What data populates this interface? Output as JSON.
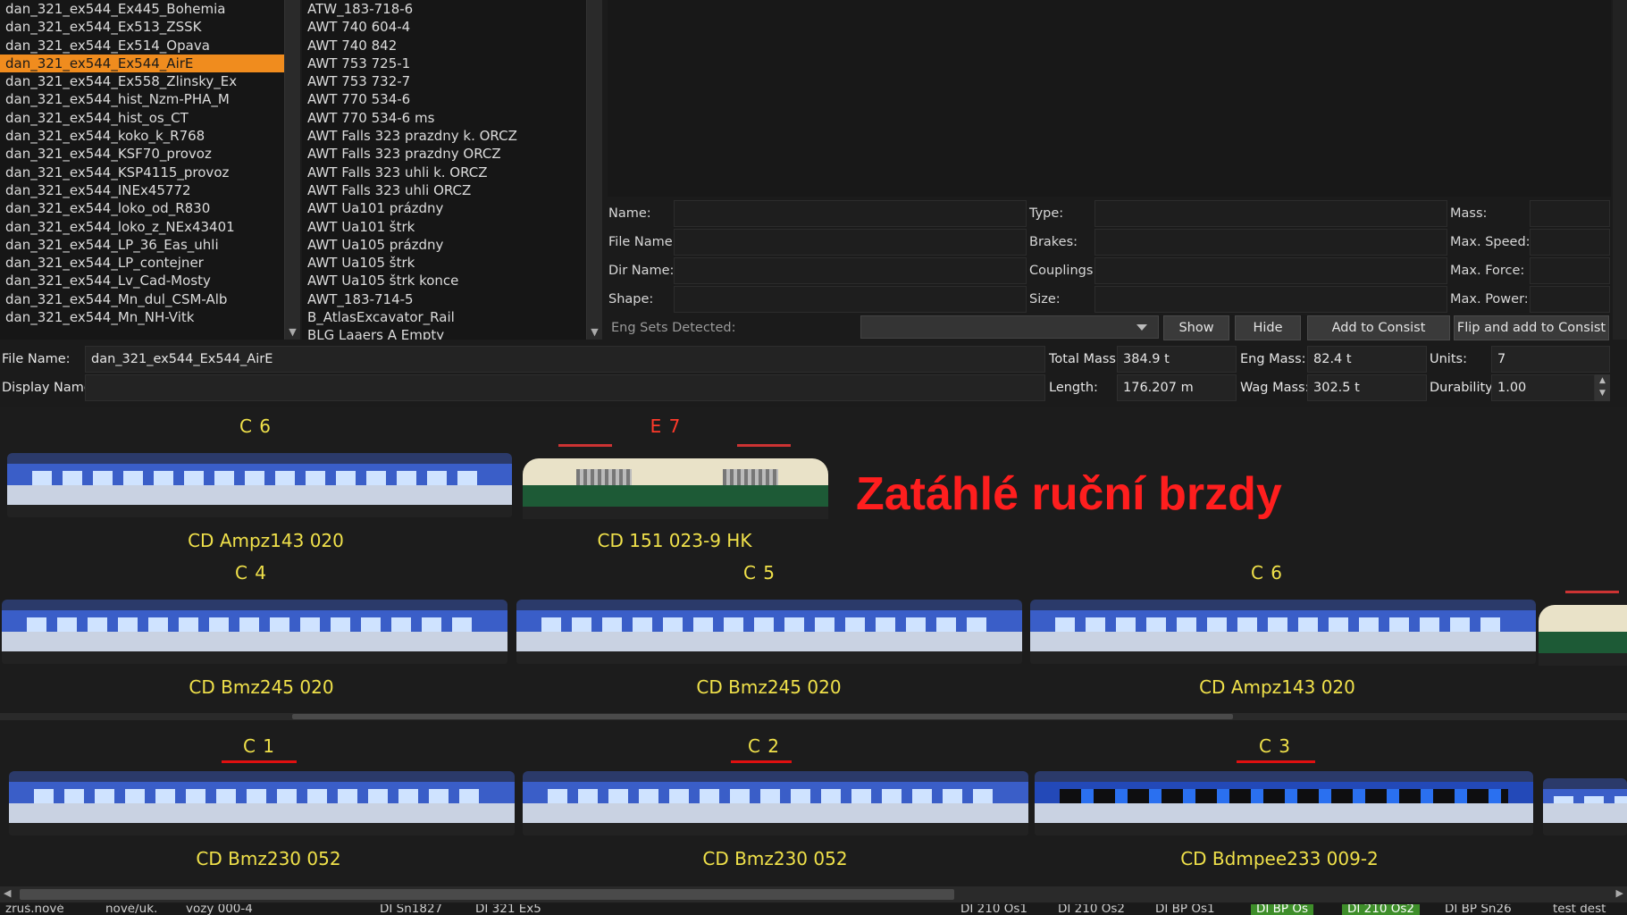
{
  "consist_list": {
    "items": [
      "dan_321_ex544_Ex445_Bohemia",
      "dan_321_ex544_Ex513_ZSSK",
      "dan_321_ex544_Ex514_Opava",
      "dan_321_ex544_Ex544_AirE",
      "dan_321_ex544_Ex558_Zlinsky_Ex",
      "dan_321_ex544_hist_Nzm-PHA_M",
      "dan_321_ex544_hist_os_CT",
      "dan_321_ex544_koko_k_R768",
      "dan_321_ex544_KSF70_provoz",
      "dan_321_ex544_KSP4115_provoz",
      "dan_321_ex544_INEx45772",
      "dan_321_ex544_loko_od_R830",
      "dan_321_ex544_loko_z_NEx43401",
      "dan_321_ex544_LP_36_Eas_uhli",
      "dan_321_ex544_LP_contejner",
      "dan_321_ex544_Lv_Cad-Mosty",
      "dan_321_ex544_Mn_dul_CSM-Alb",
      "dan_321_ex544_Mn_NH-Vitk"
    ],
    "selected": "dan_321_ex544_Ex544_AirE"
  },
  "wagon_list": {
    "items": [
      "ATW_183-718-6",
      "AWT 740 604-4",
      "AWT 740 842",
      "AWT 753 725-1",
      "AWT 753 732-7",
      "AWT 770 534-6",
      "AWT 770 534-6 ms",
      "AWT Falls 323 prazdny k. ORCZ",
      "AWT Falls 323 prazdny ORCZ",
      "AWT Falls 323 uhli k. ORCZ",
      "AWT Falls 323 uhli ORCZ",
      "AWT Ua101 prázdny",
      "AWT Ua101 štrk",
      "AWT Ua105 prázdny",
      "AWT Ua105 štrk",
      "AWT Ua105 štrk konce",
      "AWT_183-714-5",
      "B_AtlasExcavator_Rail",
      "BLG Laaers A Empty"
    ]
  },
  "properties": {
    "name_label": "Name:",
    "file_name_label": "File Name:",
    "dir_name_label": "Dir Name:",
    "shape_label": "Shape:",
    "type_label": "Type:",
    "brakes_label": "Brakes:",
    "couplings_label": "Couplings:",
    "size_label": "Size:",
    "mass_label": "Mass:",
    "max_speed_label": "Max. Speed:",
    "max_force_label": "Max. Force:",
    "max_power_label": "Max. Power:",
    "eng_sets_label": "Eng Sets Detected:",
    "show_button": "Show",
    "hide_button": "Hide",
    "add_button": "Add to Consist",
    "flip_add_button": "Flip and add to Consist"
  },
  "consist_info": {
    "file_name_label": "File Name:",
    "file_name_value": "dan_321_ex544_Ex544_AirE",
    "display_name_label": "Display Name:",
    "display_name_value": "",
    "total_mass_label": "Total Mass:",
    "total_mass_value": "384.9 t",
    "length_label": "Length:",
    "length_value": "176.207 m",
    "eng_mass_label": "Eng Mass:",
    "eng_mass_value": "82.4 t",
    "wag_mass_label": "Wag Mass:",
    "wag_mass_value": "302.5 t",
    "units_label": "Units:",
    "units_value": "7",
    "durability_label": "Durability:",
    "durability_value": "1.00"
  },
  "consist_view": {
    "warning": "Zatáhlé ruční brzdy",
    "row1": [
      {
        "code": "C 6",
        "name": "CD Ampz143 020"
      },
      {
        "code": "E 7",
        "name": "CD 151 023-9 HK"
      }
    ],
    "row2": [
      {
        "code": "C 4",
        "name": "CD Bmz245 020"
      },
      {
        "code": "C 5",
        "name": "CD Bmz245 020"
      },
      {
        "code": "C 6",
        "name": "CD Ampz143 020"
      }
    ],
    "row3": [
      {
        "code": "C 1",
        "name": "CD Bmz230 052"
      },
      {
        "code": "C 2",
        "name": "CD Bmz230 052"
      },
      {
        "code": "C 3",
        "name": "CD Bdmpee233 009-2"
      }
    ]
  },
  "bottom_tabs": [
    "zruš.nové",
    "nové/uk.",
    "vozy 000-4",
    "DI Sn1827",
    "DI 321 Ex5",
    "DI 210 Os1",
    "DI 210 Os2",
    "DI BP Os1",
    "DI BP Os",
    "DI 210 Os2",
    "DI BP Sn26",
    "test dest"
  ],
  "colors": {
    "selection": "#f08c1e",
    "car_label": "#f0e14a",
    "warning": "#ff1e1e"
  }
}
